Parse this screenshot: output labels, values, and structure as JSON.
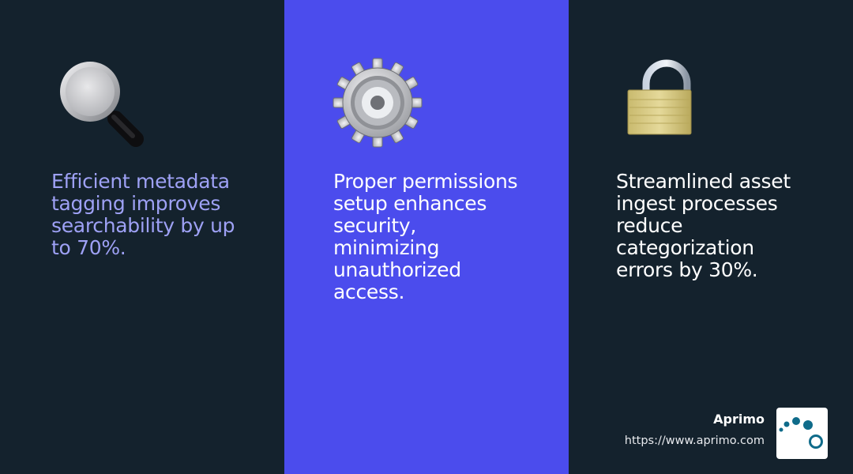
{
  "columns": [
    {
      "icon": "magnifying-glass-icon",
      "text": "Efficient metadata tagging improves searchability by up to 70%.",
      "background": "#14222d",
      "text_color": "#9ea1f5"
    },
    {
      "icon": "gear-icon",
      "text": "Proper permissions setup enhances security, minimizing unauthorized access.",
      "background": "#4b4ced",
      "text_color": "#ffffff"
    },
    {
      "icon": "padlock-icon",
      "text": "Streamlined asset ingest processes reduce categorization errors by 30%.",
      "background": "#14222d",
      "text_color": "#ffffff"
    }
  ],
  "brand": {
    "name": "Aprimo",
    "url": "https://www.aprimo.com",
    "logo_icon": "aprimo-logo-icon",
    "logo_color": "#0f6b8a"
  }
}
